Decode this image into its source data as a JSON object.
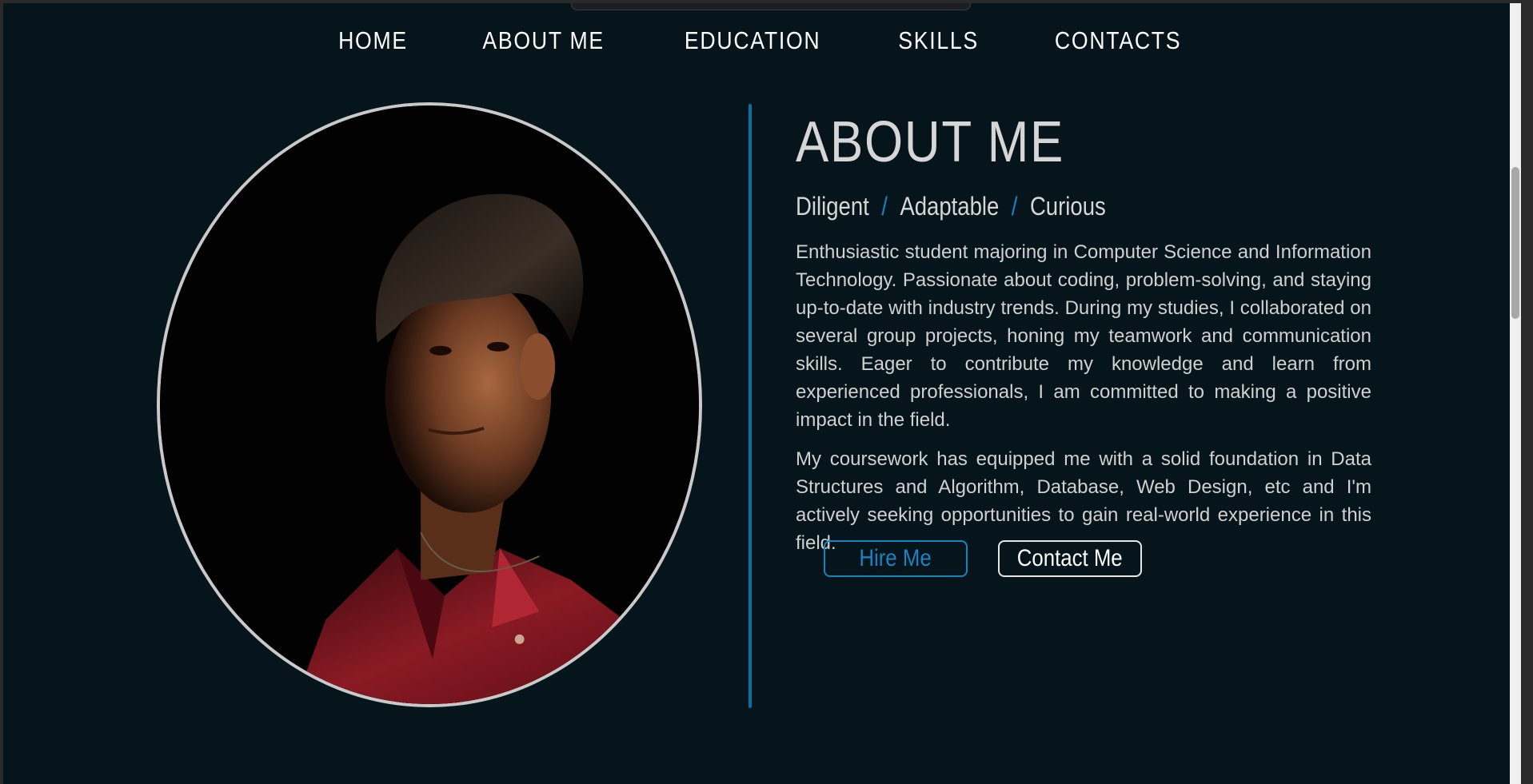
{
  "nav": {
    "items": [
      {
        "label": "HOME"
      },
      {
        "label": "ABOUT ME"
      },
      {
        "label": "EDUCATION"
      },
      {
        "label": "SKILLS"
      },
      {
        "label": "CONTACTS"
      }
    ]
  },
  "about": {
    "title": "ABOUT ME",
    "traits": [
      "Diligent",
      "Adaptable",
      "Curious"
    ],
    "trait_separator": "/",
    "paragraphs": [
      "Enthusiastic student majoring in Computer Science and Information Technology. Passionate about coding, problem-solving, and staying up-to-date with industry trends. During my studies, I collaborated on several group projects, honing my teamwork and communication skills. Eager to contribute my knowledge and learn from experienced professionals, I am committed to making a positive impact in the field.",
      "My coursework has equipped me with a solid foundation in Data Structures and Algorithm, Database, Web Design, etc and I'm actively seeking opportunities to gain real-world experience in this field."
    ]
  },
  "buttons": {
    "hire": "Hire Me",
    "contact": "Contact Me"
  },
  "colors": {
    "background": "#06141b",
    "accent": "#1684c2",
    "text": "#d6d6d6"
  }
}
